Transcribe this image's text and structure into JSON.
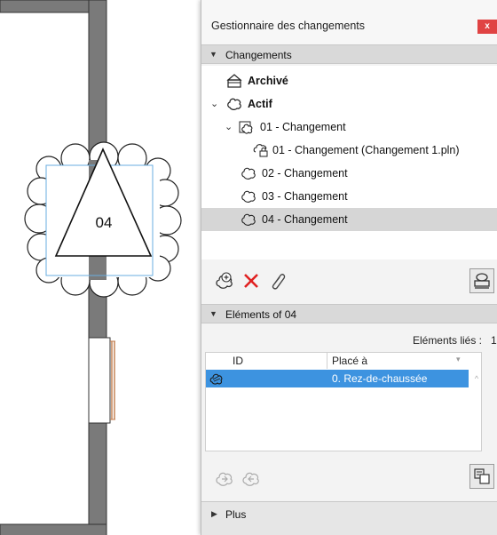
{
  "plan": {
    "tag_label": "04"
  },
  "panel": {
    "title": "Gestionnaire des changements",
    "close_label": "x",
    "changes_section": {
      "label": "Changements",
      "items": [
        {
          "label": "Archivé",
          "bold": true
        },
        {
          "label": "Actif",
          "bold": true
        },
        {
          "label": "01 - Changement"
        },
        {
          "label": "01 - Changement (Changement 1.pln)"
        },
        {
          "label": "02 - Changement"
        },
        {
          "label": "03 - Changement"
        },
        {
          "label": "04 - Changement",
          "selected": true
        }
      ]
    },
    "toolbar": {
      "new_icon": "add-change-icon",
      "delete_icon": "delete-x-icon",
      "link_icon": "paperclip-icon",
      "stamp_icon": "stamp-icon"
    },
    "elements_section": {
      "label": "Eléments of 04",
      "linked_label": "Eléments liés :",
      "linked_count": "1",
      "columns": [
        "ID",
        "Placé à"
      ],
      "rows": [
        {
          "id_icon": "element-icon",
          "placed": "0. Rez-de-chaussée"
        }
      ]
    },
    "more": {
      "label": "Plus"
    },
    "colors": {
      "selection": "#3d93e0",
      "close": "#e04343",
      "accent_delete": "#e02020"
    }
  }
}
